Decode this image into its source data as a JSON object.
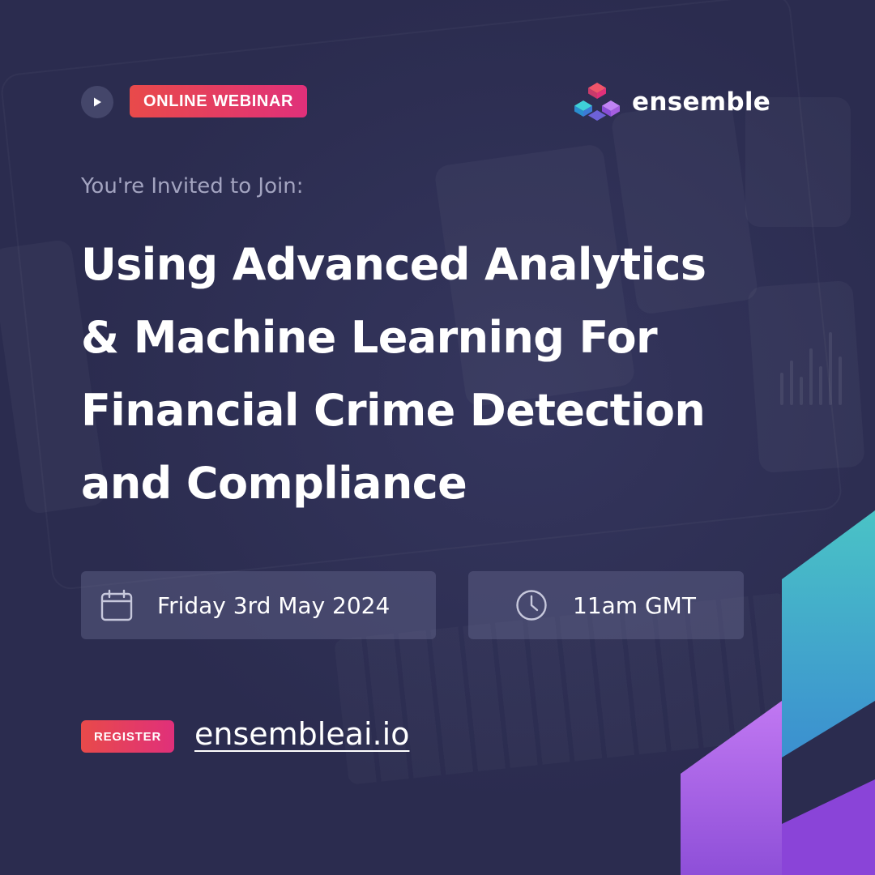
{
  "header": {
    "badge_label": "ONLINE WEBINAR",
    "brand_name": "ensemble"
  },
  "intro": {
    "subtitle": "You're Invited to Join:",
    "headline_lines": [
      "Using Advanced Analytics",
      "& Machine Learning For",
      "Financial Crime Detection",
      "and Compliance"
    ]
  },
  "event": {
    "date_label": "Friday 3rd May 2024",
    "time_label": "11am GMT",
    "date_icon": "calendar-icon",
    "time_icon": "clock-icon"
  },
  "cta": {
    "register_label": "REGISTER",
    "site": "ensembleai.io"
  },
  "colors": {
    "background": "#2b2c4f",
    "badge_gradient_start": "#e84a4a",
    "badge_gradient_end": "#e0307a",
    "pill_background": "#545678",
    "subtitle_text": "#a3a4c0",
    "accent_teal": "#3fb8c4",
    "accent_purple": "#a45ee0"
  }
}
